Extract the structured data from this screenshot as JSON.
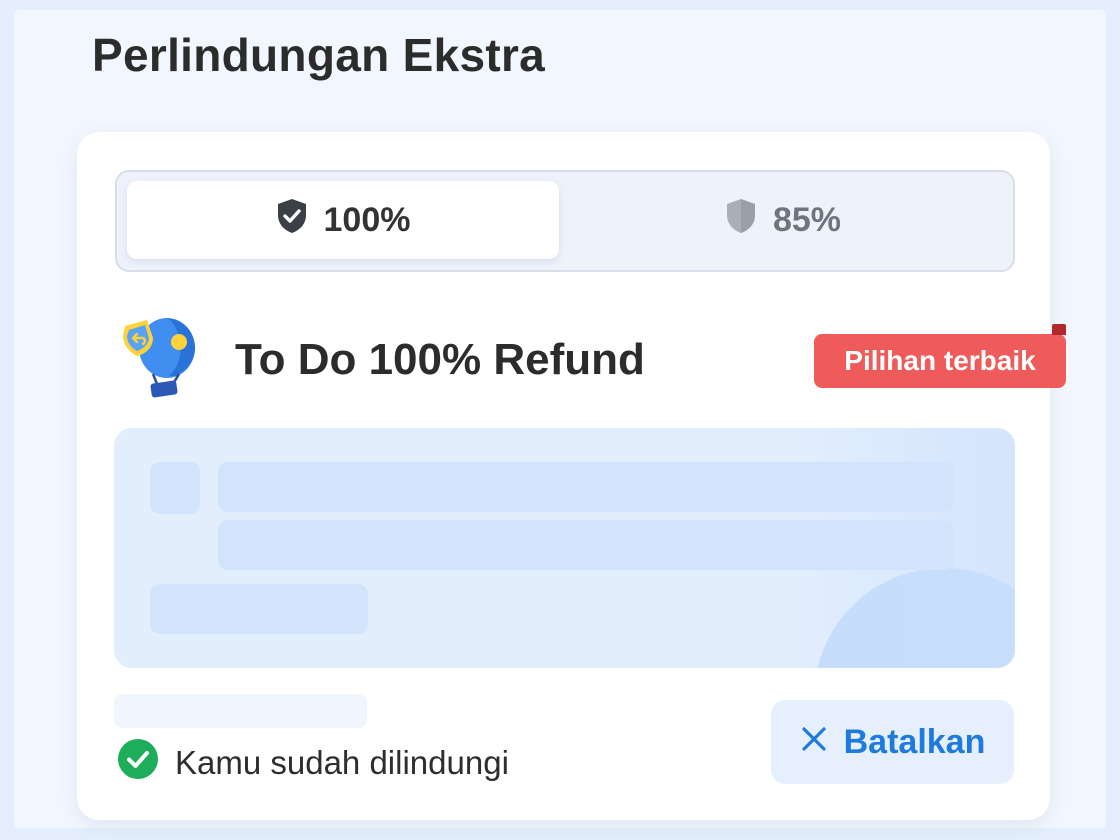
{
  "page": {
    "title": "Perlindungan Ekstra"
  },
  "tabs": [
    {
      "label": "100%",
      "icon": "shield-check-icon",
      "selected": true
    },
    {
      "label": "85%",
      "icon": "shield-icon",
      "selected": false
    }
  ],
  "product": {
    "title": "To Do 100% Refund",
    "icon": "refund-balloon-icon",
    "badge": "Pilihan terbaik"
  },
  "status": {
    "text": "Kamu sudah dilindungi",
    "icon": "check-circle-icon"
  },
  "cancel_button": {
    "label": "Batalkan",
    "icon": "close-icon"
  },
  "colors": {
    "accent": "#1f7ae0",
    "badge": "#ef5b5b",
    "success": "#1ead5a",
    "text": "#2c2c2c"
  }
}
